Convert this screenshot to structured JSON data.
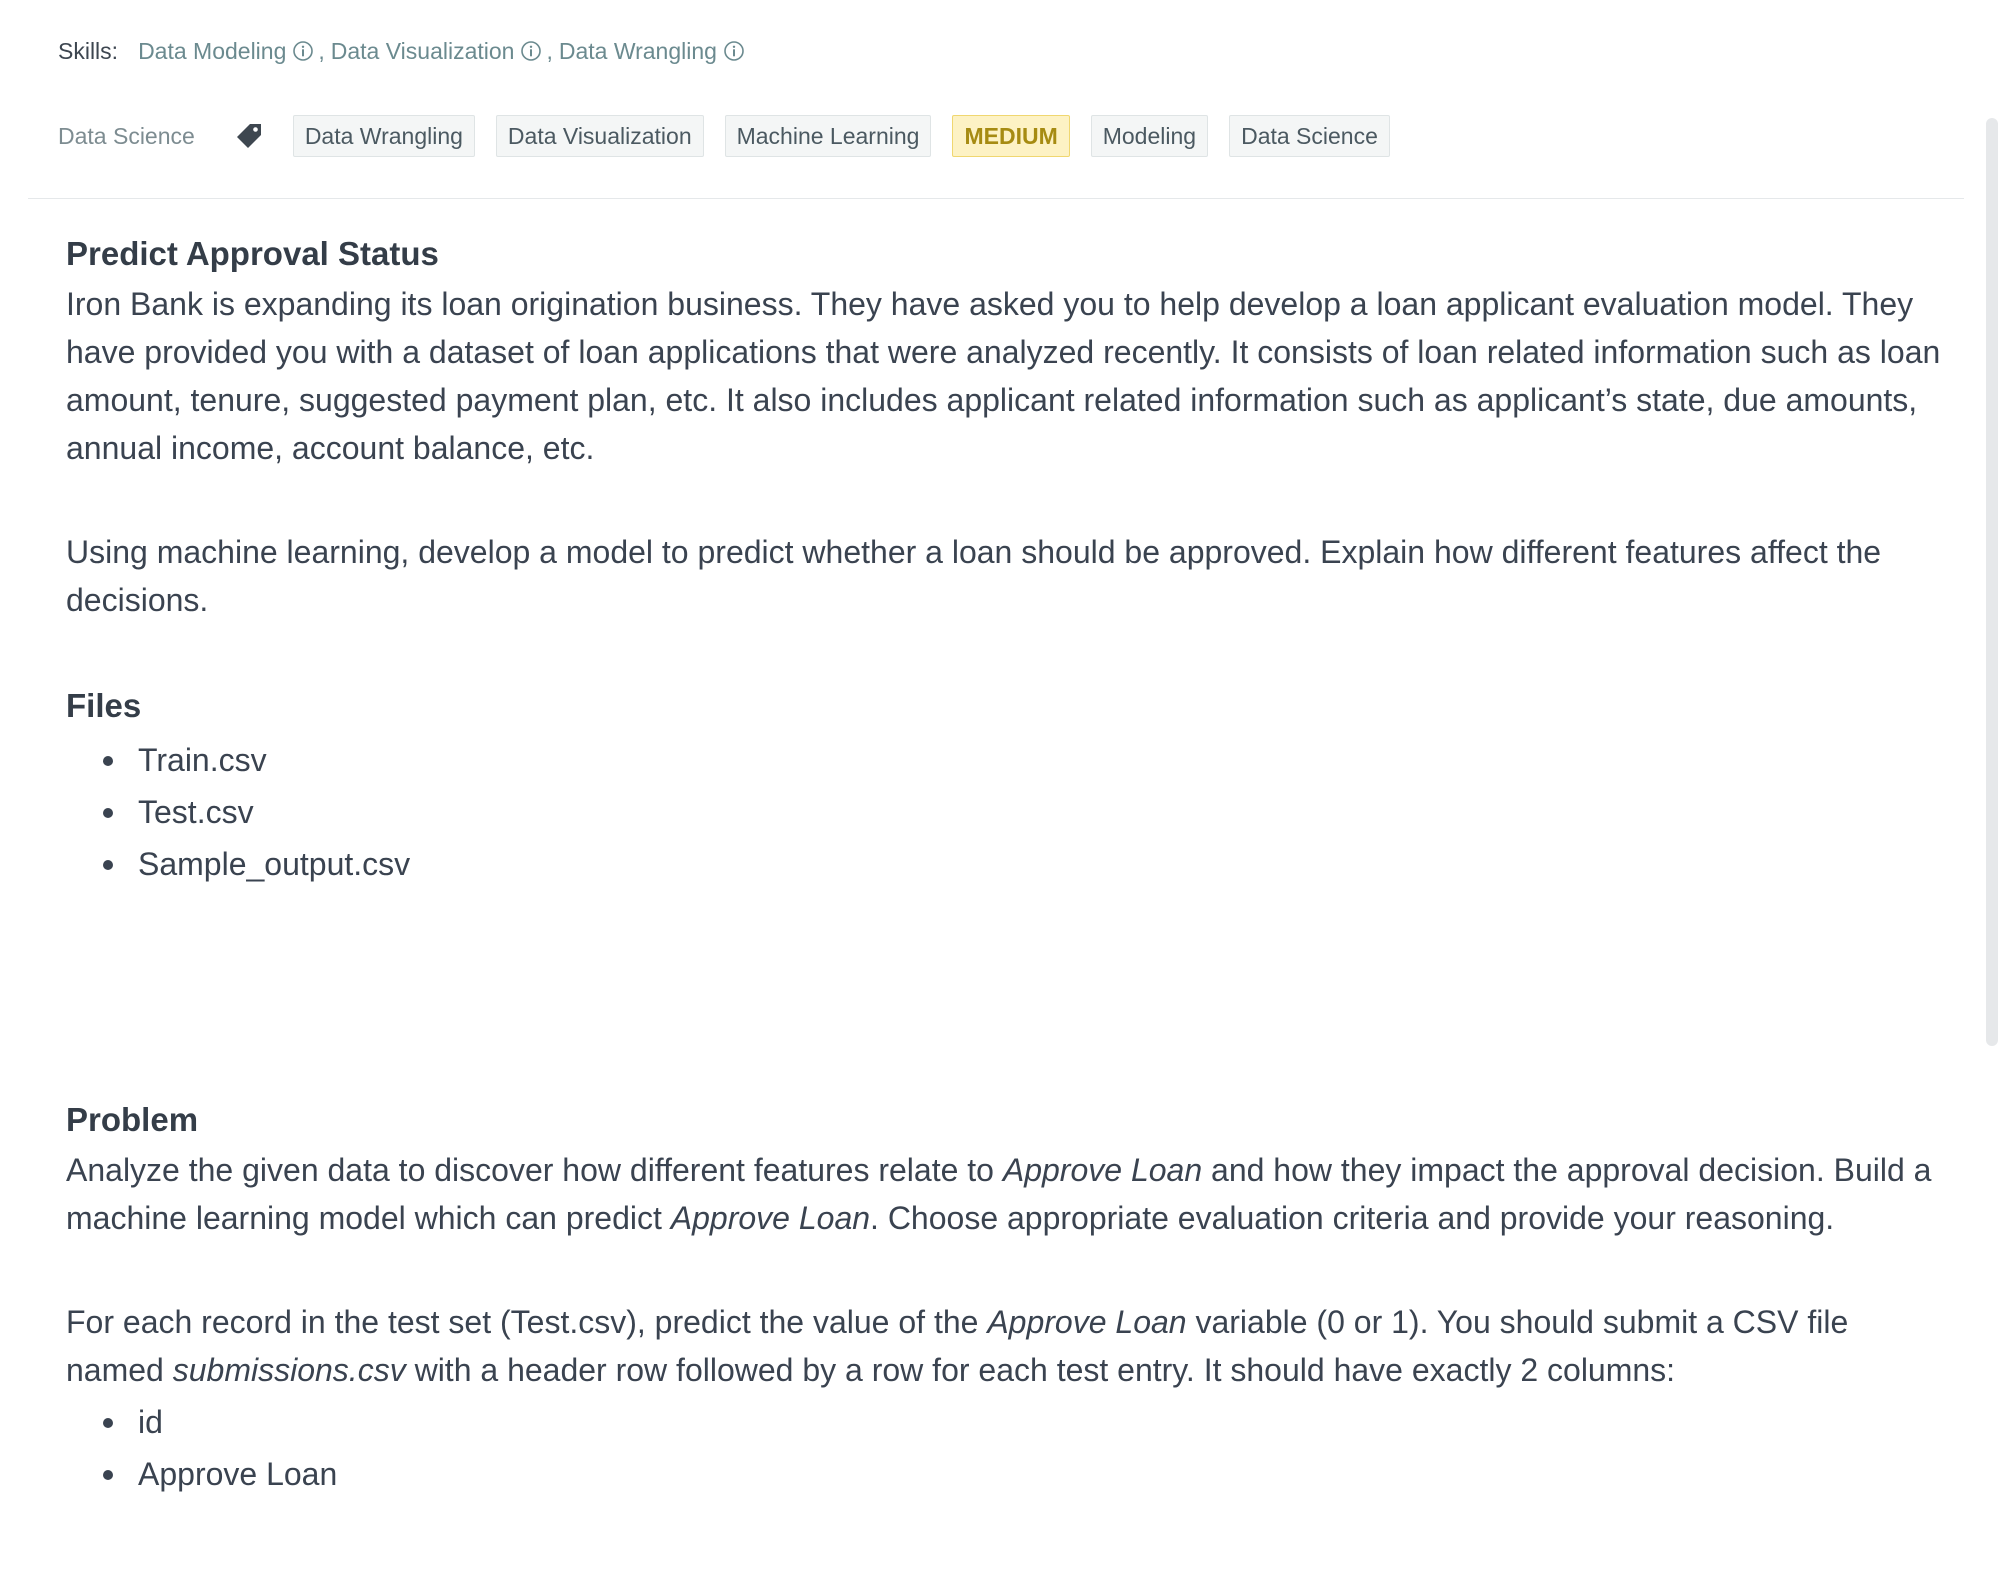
{
  "skills": {
    "label": "Skills:",
    "items": [
      "Data Modeling",
      "Data Visualization",
      "Data Wrangling"
    ],
    "separator": ","
  },
  "category": "Data Science",
  "tags": [
    "Data Wrangling",
    "Data Visualization",
    "Machine Learning",
    "MEDIUM",
    "Modeling",
    "Data Science"
  ],
  "difficulty_color": "#fdf2c4",
  "icons": [
    "info-icon",
    "tag-icon"
  ],
  "task": {
    "title": "Predict Approval Status",
    "intro": "Iron Bank is expanding its loan origination business. They have asked you to help develop a loan applicant evaluation model. They have provided you with a dataset of loan applications that were analyzed recently. It consists of loan related information such as loan amount, tenure, suggested payment plan, etc. It also includes applicant related information such as applicant’s state, due amounts, annual income, account balance, etc.",
    "goal": "Using machine learning, develop a model to predict whether a loan should be approved. Explain how different features affect the decisions.",
    "files_heading": "Files",
    "files": [
      "Train.csv",
      "Test.csv",
      "Sample_output.csv"
    ],
    "problem_heading": "Problem",
    "problem_p1": {
      "a": "Analyze the given data to discover how different features relate to ",
      "em1": "Approve Loan",
      "b": " and how they impact the approval decision. Build a machine learning model which can predict ",
      "em2": "Approve Loan",
      "c": ". Choose appropriate evaluation criteria and provide your reasoning."
    },
    "problem_p2": {
      "a": "For each record in the test set (Test.csv), predict the value of the ",
      "em1": "Approve Loan",
      "b": " variable (0 or 1). You should submit a CSV file named ",
      "em2": "submissions.csv",
      "c": " with a header row followed by a row for each test entry. It should have exactly 2 columns:"
    },
    "columns": [
      "id",
      "Approve Loan"
    ]
  }
}
